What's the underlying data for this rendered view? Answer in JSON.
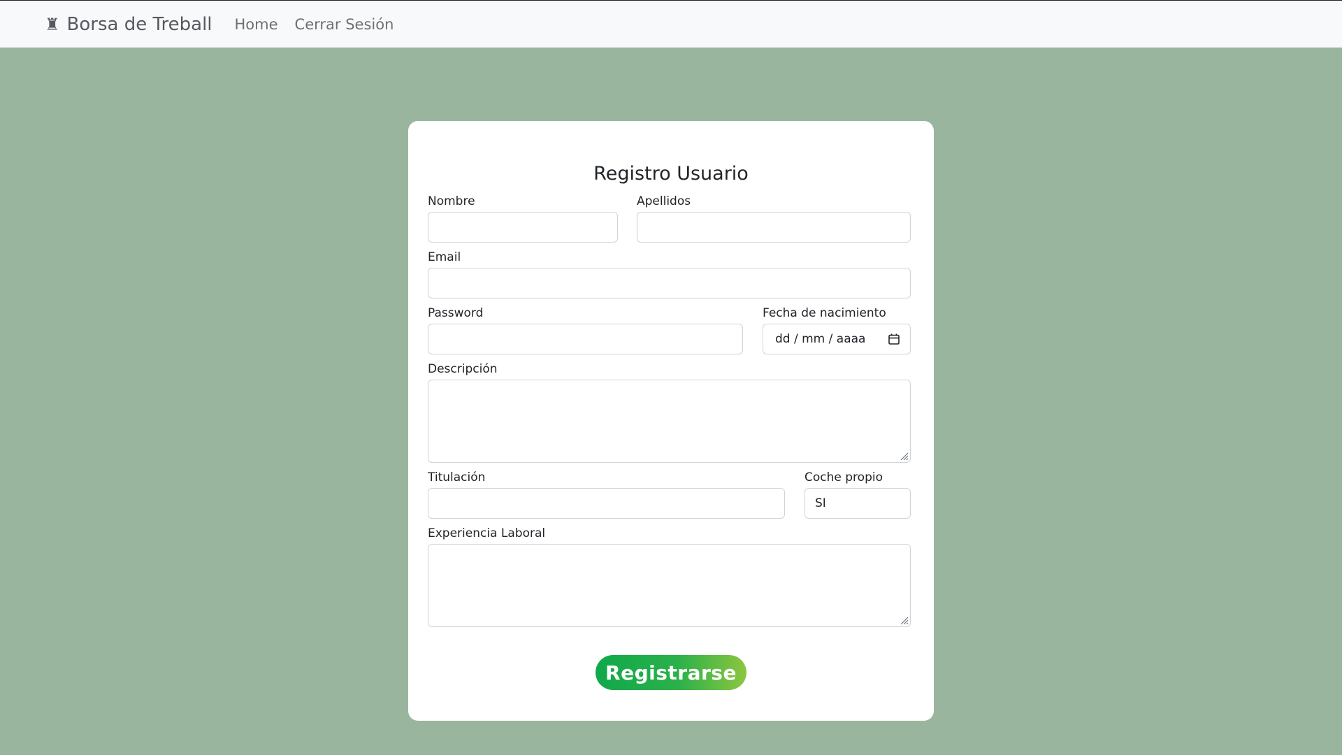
{
  "navbar": {
    "brand_icon": "rook-chess-icon",
    "brand_glyph": "♜",
    "brand_label": "Borsa de Treball",
    "links": [
      {
        "label": "Home"
      },
      {
        "label": "Cerrar Sesión"
      }
    ]
  },
  "form": {
    "title": "Registro Usuario",
    "fields": {
      "nombre": {
        "label": "Nombre",
        "value": ""
      },
      "apellidos": {
        "label": "Apellidos",
        "value": ""
      },
      "email": {
        "label": "Email",
        "value": ""
      },
      "password": {
        "label": "Password",
        "value": ""
      },
      "fecha": {
        "label": "Fecha de nacimiento",
        "placeholder": "dd / mm / aaaa",
        "icon": "calendar-icon"
      },
      "descripcion": {
        "label": "Descripción",
        "value": ""
      },
      "titulacion": {
        "label": "Titulación",
        "value": ""
      },
      "coche": {
        "label": "Coche propio",
        "selected": "SI"
      },
      "experiencia": {
        "label": "Experiencia Laboral",
        "value": ""
      }
    },
    "submit_label": "Registrarse"
  },
  "colors": {
    "page_background": "#9ab59d",
    "navbar_background": "#f8f9fa",
    "card_background": "#ffffff",
    "button_gradient_start": "#0fa84b",
    "button_gradient_end": "#8cc63f"
  }
}
